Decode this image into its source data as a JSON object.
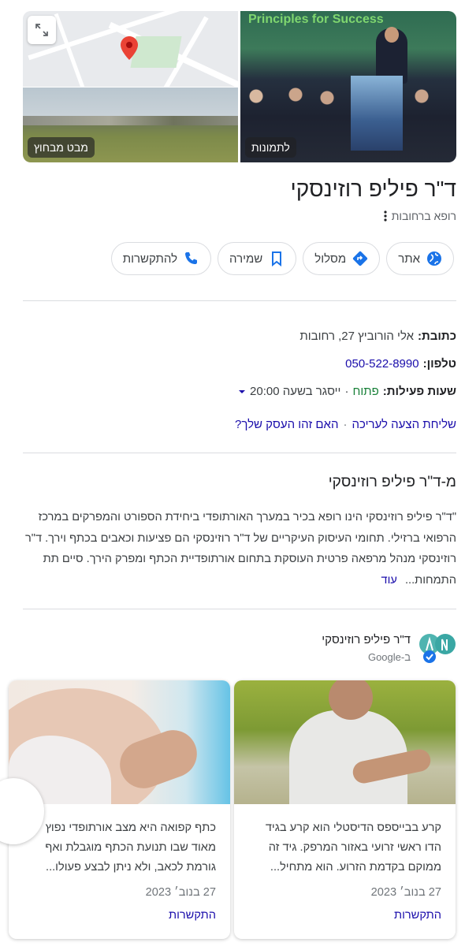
{
  "media": {
    "street_view_label": "מבט מבחוץ",
    "photos_label": "לתמונות",
    "photo_overlay_text": "Principles for Success"
  },
  "business": {
    "name": "ד\"ר פיליפ רוזינסקי",
    "category": "רופא ברחובות"
  },
  "actions": [
    {
      "label": "אתר",
      "icon": "globe-icon"
    },
    {
      "label": "מסלול",
      "icon": "directions-icon"
    },
    {
      "label": "שמירה",
      "icon": "bookmark-icon"
    },
    {
      "label": "להתקשרות",
      "icon": "phone-icon"
    }
  ],
  "info": {
    "address_label": "כתובת:",
    "address_value": "אלי הורוביץ 27, רחובות",
    "phone_label": "טלפון:",
    "phone_value": "050-522-8990",
    "hours_label": "שעות פעילות:",
    "hours_status": "פתוח",
    "hours_sep": "·",
    "hours_detail": "ייסגר בשעה 20:00"
  },
  "suggest": {
    "edit": "שליחת הצעה לעריכה",
    "sep": "·",
    "own": "האם זהו העסק שלך?"
  },
  "about": {
    "title": "מ-ד\"ר פיליפ רוזינסקי",
    "text": "\"ד\"ר פיליפ רוזינסקי הינו רופא בכיר במערך האורתופדי ביחידת הספורט והמפרקים במרכז הרפואי ברזילי. תחומי העיסוק העיקריים של ד\"ר רוזינסקי הם פציעות וכאבים בכתף וירך. ד\"ר רוזינסקי מנהל מרפאה פרטית העוסקת בתחום אורתופדיית הכתף ומפרק הירך. סיים תת התמחות...",
    "more": "עוד"
  },
  "posts_header": {
    "name": "ד\"ר פיליפ רוזינסקי",
    "via": "ב-Google"
  },
  "posts": [
    {
      "text": "קרע בבייספס הדיסטלי הוא קרע בגיד הדו ראשי זרועי באזור המרפק. גיד זה ממוקם בקדמת הזרוע. הוא מתחיל...",
      "date": "27 בנוב׳ 2023",
      "cta": "התקשרות"
    },
    {
      "text": "כתף קפואה היא מצב אורתופדי נפוץ מאוד שבו תנועת הכתף מוגבלת ואף גורמת לכאב, ולא ניתן לבצע פעולו...",
      "date": "27 בנוב׳ 2023",
      "cta": "התקשרות"
    }
  ],
  "colors": {
    "link": "#1a0dab",
    "open": "#188038",
    "icon_blue": "#1a73e8",
    "pin_red": "#ea4335"
  }
}
